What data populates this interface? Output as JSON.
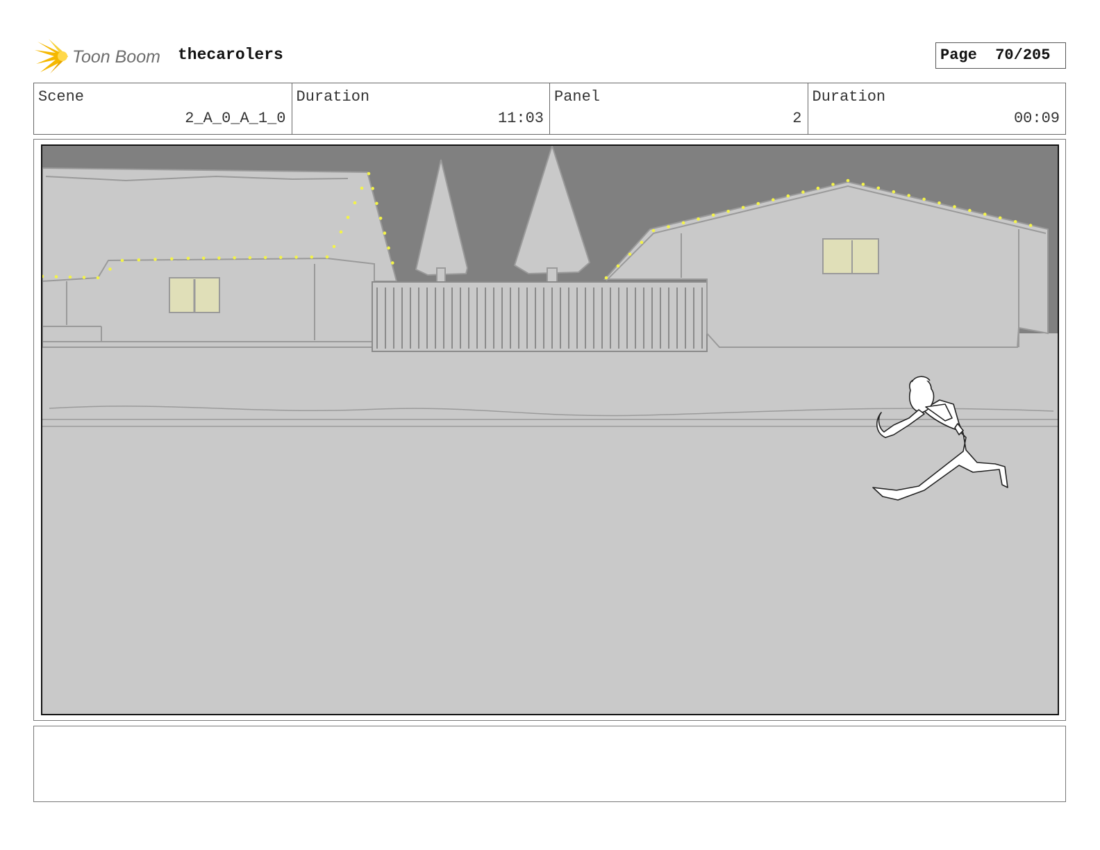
{
  "logo": {
    "text": "Toon Boom",
    "icon": "sunburst-logo-icon",
    "color": "#f5c518"
  },
  "project": {
    "title": "thecarolers"
  },
  "page": {
    "label": "Page  70/205"
  },
  "info": {
    "scene_label": "Scene",
    "scene_value": "2_A_0_A_1_0",
    "scene_duration_label": "Duration",
    "scene_duration_value": "11:03",
    "panel_label": "Panel",
    "panel_value": "2",
    "panel_duration_label": "Duration",
    "panel_duration_value": "00:09"
  },
  "colors": {
    "sky": "#808080",
    "ground": "#c9c9c9",
    "lights": "#f3f34a",
    "window": "#e0dfb8"
  },
  "notes": {
    "text": ""
  }
}
